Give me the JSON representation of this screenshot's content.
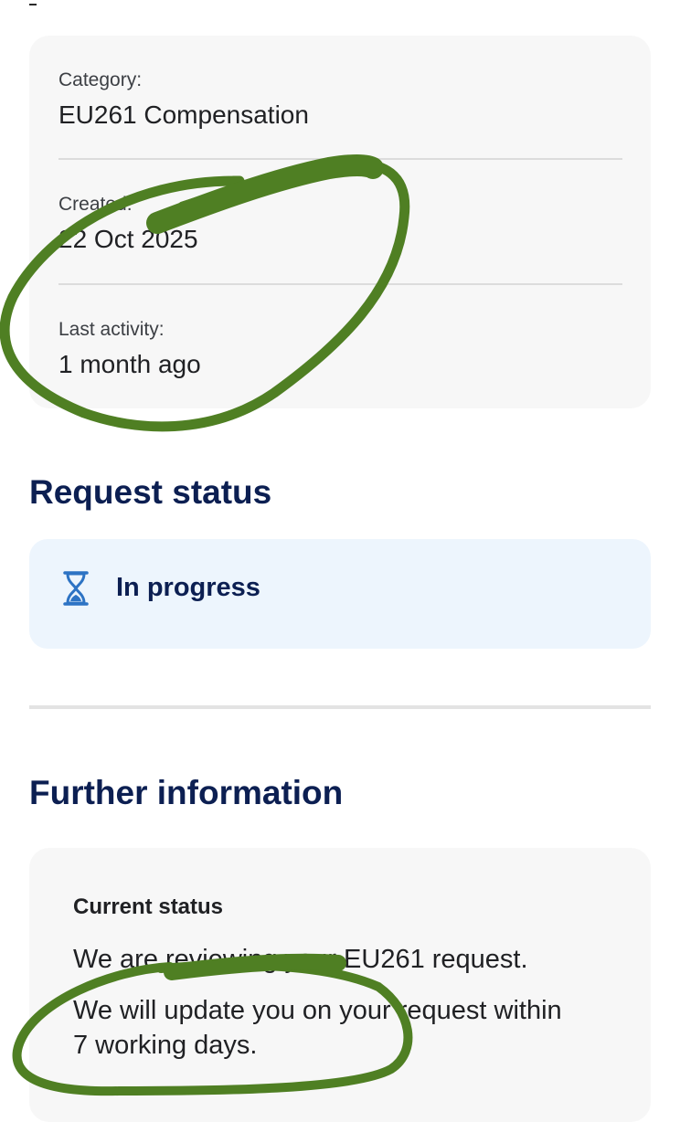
{
  "details": {
    "category_label": "Category:",
    "category_value": "EU261 Compensation",
    "created_label": "Created:",
    "created_value": "22 Oct 2025",
    "last_activity_label": "Last activity:",
    "last_activity_value": "1 month ago"
  },
  "request_status": {
    "heading": "Request status",
    "status_text": "In progress",
    "status_icon": "hourglass-icon",
    "accent_color": "#2d73c4"
  },
  "further_information": {
    "heading": "Further information",
    "card_title": "Current status",
    "line_1": "We are reviewing your EU261 request.",
    "line_2a": "We will update you on your request within",
    "line_2b": "7 working days."
  },
  "colors": {
    "heading": "#0c1f52",
    "card_background": "#f7f7f7",
    "status_background": "#edf5fd",
    "annotation_green": "#4f7f23"
  }
}
